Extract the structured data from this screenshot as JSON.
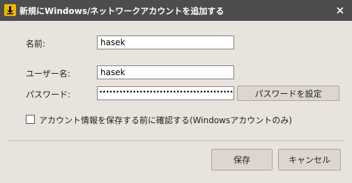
{
  "dialog": {
    "title": "新規にWindows/ネットワークアカウントを追加する",
    "app_icon": "download-icon",
    "close_icon": "close-icon"
  },
  "form": {
    "name_label": "名前:",
    "name_value": "hasek",
    "username_label": "ユーザー名:",
    "username_value": "hasek",
    "password_label": "パスワード:",
    "password_value": "••••••••••••••••••••••••••••••••••••••••••",
    "set_password_button": "パスワードを設定",
    "confirm_checkbox_label": "アカウント情報を保存する前に確認する(Windowsアカウントのみ)",
    "confirm_checked": false
  },
  "footer": {
    "save_button": "保存",
    "cancel_button": "キャンセル"
  }
}
